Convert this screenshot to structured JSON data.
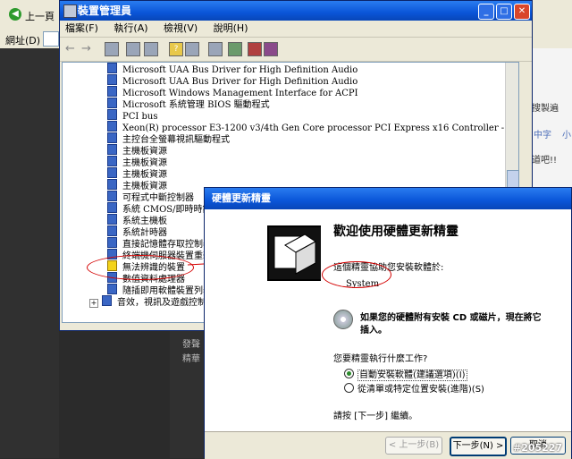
{
  "browser": {
    "back_label": "上一頁",
    "addr_label": "網址(D)",
    "side_labels": [
      "搜製遍",
      "中字",
      "小",
      "道吧!!"
    ],
    "bottom_labels": [
      "發聲",
      "精華"
    ]
  },
  "devmgr": {
    "title": "裝置管理員",
    "menu": [
      "檔案(F)",
      "執行(A)",
      "檢視(V)",
      "說明(H)"
    ],
    "tree_items": [
      {
        "label": "Microsoft UAA Bus Driver for High Definition Audio",
        "icon": "device-icon"
      },
      {
        "label": "Microsoft UAA Bus Driver for High Definition Audio",
        "icon": "device-icon"
      },
      {
        "label": "Microsoft Windows Management Interface for ACPI",
        "icon": "device-icon"
      },
      {
        "label": "Microsoft 系統管理 BIOS 驅動程式",
        "icon": "device-icon"
      },
      {
        "label": "PCI bus",
        "icon": "device-icon"
      },
      {
        "label": "Xeon(R) processor E3-1200 v3/4th Gen Core processor PCI Express x16 Controller - 0C01",
        "icon": "device-icon"
      },
      {
        "label": "主控台全螢幕視訊驅動程式",
        "icon": "device-icon"
      },
      {
        "label": "主機板資源",
        "icon": "device-icon"
      },
      {
        "label": "主機板資源",
        "icon": "device-icon"
      },
      {
        "label": "主機板資源",
        "icon": "device-icon"
      },
      {
        "label": "主機板資源",
        "icon": "device-icon"
      },
      {
        "label": "可程式中斷控制器",
        "icon": "device-icon"
      },
      {
        "label": "系統 CMOS/即時時鐘",
        "icon": "device-icon"
      },
      {
        "label": "系統主機板",
        "icon": "device-icon"
      },
      {
        "label": "系統計時器",
        "icon": "device-icon"
      },
      {
        "label": "直接記憶體存取控制器",
        "icon": "device-icon"
      },
      {
        "label": "終端機伺服器裝置重新",
        "icon": "device-icon"
      },
      {
        "label": "無法辨識的裝置",
        "icon": "warning-icon"
      },
      {
        "label": "數值資料處理器",
        "icon": "device-icon"
      },
      {
        "label": "隨插即用軟體裝置列舉",
        "icon": "device-icon"
      },
      {
        "label": "音效，視訊及遊戲控制器",
        "icon": "sound-icon"
      }
    ]
  },
  "wizard": {
    "title": "硬體更新精靈",
    "heading": "歡迎使用硬體更新精靈",
    "intro": "這個精靈協助您安裝軟體於:",
    "device": "System",
    "cd_prompt_1": "如果您的硬體附有安裝 CD 或磁片，現在將它",
    "cd_prompt_2": "插入。",
    "question": "您要精靈執行什麼工作?",
    "options": [
      "自動安裝軟體(建議選項)(I)",
      "從清單或特定位置安裝(進階)(S)"
    ],
    "selected_option": 0,
    "continue_text": "請按 [下一步] 繼續。",
    "buttons": {
      "back": "< 上一步(B)",
      "next": "下一步(N) >",
      "cancel": "取消"
    }
  },
  "watermark": "#205227"
}
